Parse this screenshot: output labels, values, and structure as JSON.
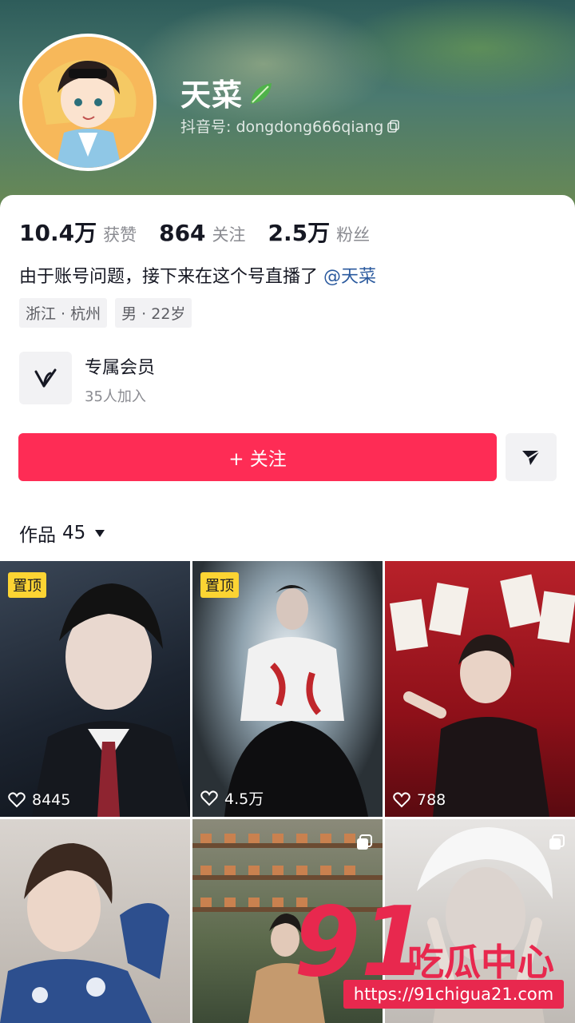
{
  "profile": {
    "nickname": "天菜",
    "nickname_emoji": "leaf-icon",
    "douyin_id": "抖音号: dongdong666qiang"
  },
  "stats": [
    {
      "value": "10.4万",
      "label": "获赞"
    },
    {
      "value": "864",
      "label": "关注"
    },
    {
      "value": "2.5万",
      "label": "粉丝"
    }
  ],
  "bio": {
    "text": "由于账号问题，接下来在这个号直播了",
    "mention": "@天菜"
  },
  "tags": [
    "浙江 · 杭州",
    "男 · 22岁"
  ],
  "membership": {
    "title": "专属会员",
    "subtitle": "35人加入"
  },
  "actions": {
    "follow_label": "+ 关注"
  },
  "works": {
    "label": "作品",
    "count": "45"
  },
  "videos": [
    {
      "pinned": "置顶",
      "likes": "8445"
    },
    {
      "pinned": "置顶",
      "likes": "4.5万"
    },
    {
      "pinned": "",
      "likes": "788"
    },
    {
      "pinned": "",
      "likes": ""
    },
    {
      "pinned": "",
      "likes": ""
    },
    {
      "pinned": "",
      "likes": ""
    }
  ],
  "watermark": {
    "number": "91",
    "text": "吃瓜中心",
    "url": "https://91chigua21.com"
  },
  "colors": {
    "follow": "#fe2c55",
    "pin": "#fcd433",
    "mention": "#2b5a9e",
    "watermark": "#e8284e"
  }
}
